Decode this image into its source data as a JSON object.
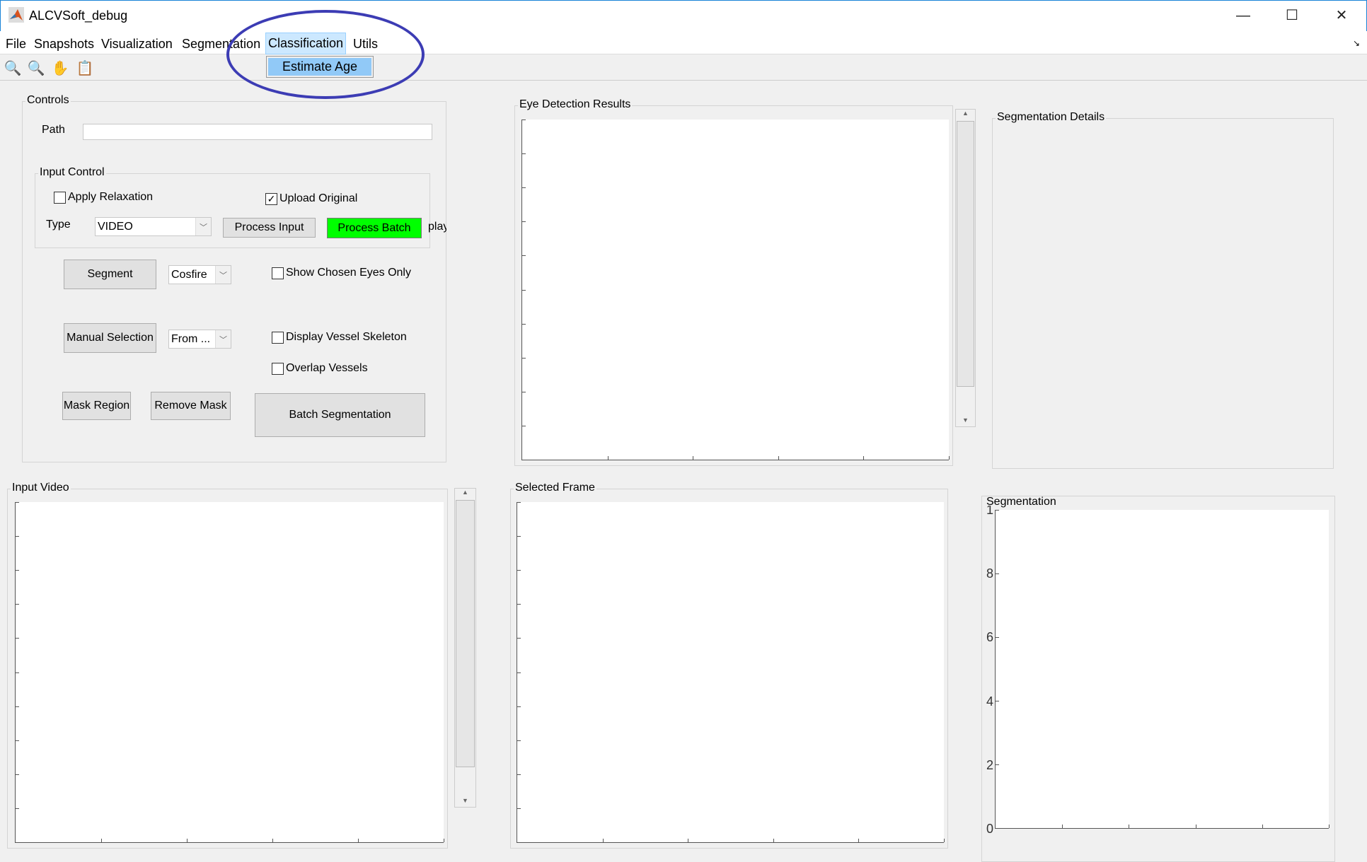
{
  "window": {
    "title": "ALCVSoft_debug",
    "minimize": "—",
    "maximize": "☐",
    "close": "✕"
  },
  "menu": {
    "items": [
      "File",
      "Snapshots",
      "Visualization",
      "Segmentation",
      "Classification",
      "Utils"
    ],
    "active": "Classification",
    "dropdown": [
      "Estimate Age"
    ]
  },
  "toolbar": {
    "icons": [
      "zoom-in-icon",
      "zoom-out-icon",
      "pan-hand-icon",
      "data-cursor-icon"
    ]
  },
  "controls": {
    "title": "Controls",
    "path_label": "Path",
    "path_value": "",
    "input_control": {
      "title": "Input Control",
      "apply_relaxation": "Apply Relaxation",
      "apply_relaxation_checked": false,
      "upload_original": "Upload Original",
      "upload_original_checked": true,
      "type_label": "Type",
      "type_value": "VIDEO",
      "process_input": "Process Input",
      "process_batch": "Process Batch",
      "clipped_text": "play"
    },
    "segment": "Segment",
    "method_value": "Cosfire",
    "show_chosen_eyes": "Show Chosen Eyes Only",
    "manual_selection": "Manual Selection",
    "from_value": "From ...",
    "display_vessel_skeleton": "Display Vessel Skeleton",
    "overlap_vessels": "Overlap Vessels",
    "mask_region": "Mask Region",
    "remove_mask": "Remove Mask",
    "batch_segmentation": "Batch Segmentation"
  },
  "panels": {
    "eye_detection": "Eye Detection Results",
    "segmentation_details": "Segmentation Details",
    "input_video": "Input Video",
    "selected_frame": "Selected Frame",
    "segmentation": "Segmentation"
  },
  "segmentation_axes": {
    "y_ticks": [
      "0",
      "2",
      "4",
      "6",
      "8",
      "1"
    ]
  },
  "colors": {
    "process_batch": "#00ff00",
    "highlight": "#cce8ff",
    "annotation": "#3c3cb4"
  }
}
